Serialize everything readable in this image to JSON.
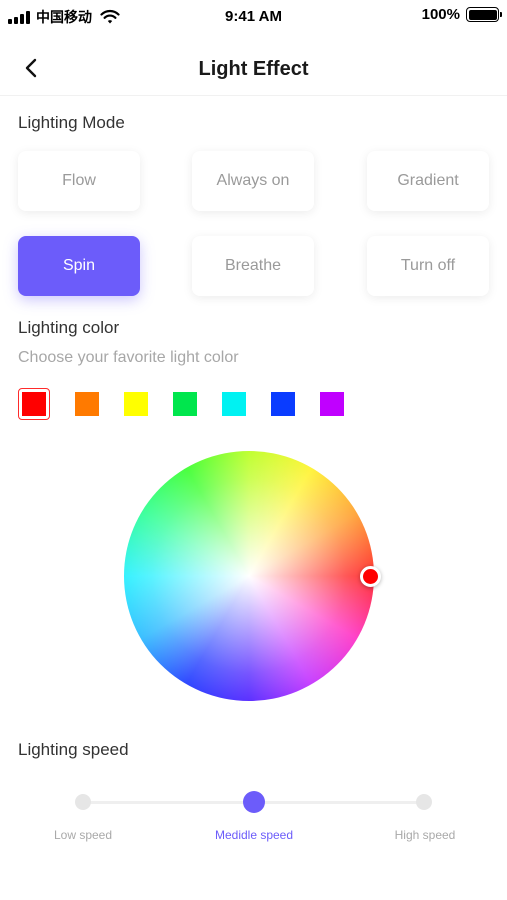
{
  "status_bar": {
    "carrier": "中国移动",
    "time": "9:41 AM",
    "battery": "100%"
  },
  "nav": {
    "title": "Light Effect"
  },
  "lighting_mode": {
    "title": "Lighting Mode",
    "modes": [
      "Flow",
      "Always on",
      "Gradient",
      "Spin",
      "Breathe",
      "Turn off"
    ],
    "selected": "Spin"
  },
  "lighting_color": {
    "title": "Lighting color",
    "subtitle": "Choose your favorite light color",
    "swatches": [
      "#ff0000",
      "#ff7a00",
      "#ffff00",
      "#00e64d",
      "#00f2f2",
      "#0a3cff",
      "#c000ff"
    ],
    "selected_swatch": "#ff0000",
    "accent": "#6c5cfa"
  },
  "lighting_speed": {
    "title": "Lighting speed",
    "levels": [
      "Low speed",
      "Medidle speed",
      "High speed"
    ],
    "selected": "Medidle speed"
  }
}
